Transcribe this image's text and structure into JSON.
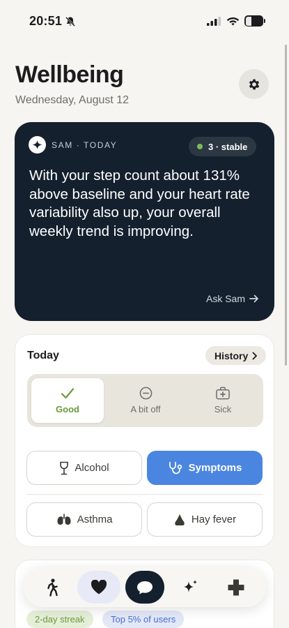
{
  "status_bar": {
    "time": "20:51",
    "battery": "35"
  },
  "header": {
    "title": "Wellbeing",
    "date": "Wednesday, August 12"
  },
  "insight": {
    "source_label": "SAM · TODAY",
    "badge": "3 · stable",
    "message": "With your step count about 131% above baseline and your heart rate variability also up, your overall weekly trend is improving.",
    "cta": "Ask Sam"
  },
  "today": {
    "title": "Today",
    "history_label": "History",
    "moods": [
      {
        "label": "Good",
        "selected": true
      },
      {
        "label": "A bit off",
        "selected": false
      },
      {
        "label": "Sick",
        "selected": false
      }
    ],
    "factors": [
      {
        "label": "Alcohol",
        "icon": "wine-glass-icon",
        "active": false
      },
      {
        "label": "Symptoms",
        "icon": "stethoscope-icon",
        "active": true
      },
      {
        "label": "Asthma",
        "icon": "lungs-icon",
        "active": false
      },
      {
        "label": "Hay fever",
        "icon": "nose-icon",
        "active": false
      }
    ]
  },
  "lower": {
    "streak": "2-day streak",
    "rank": "Top 5% of users"
  },
  "colors": {
    "background": "#f6f5f2",
    "insight_card": "#14202e",
    "accent_blue": "#4a86e0",
    "good_green": "#6a9a3c",
    "stable_dot": "#7dbb57"
  },
  "tabs": [
    {
      "icon": "walking-person-icon"
    },
    {
      "icon": "heart-icon",
      "selected": true
    },
    {
      "icon": "chat-bubble-icon"
    },
    {
      "icon": "sparkle-icon"
    },
    {
      "icon": "medical-cross-icon"
    }
  ]
}
